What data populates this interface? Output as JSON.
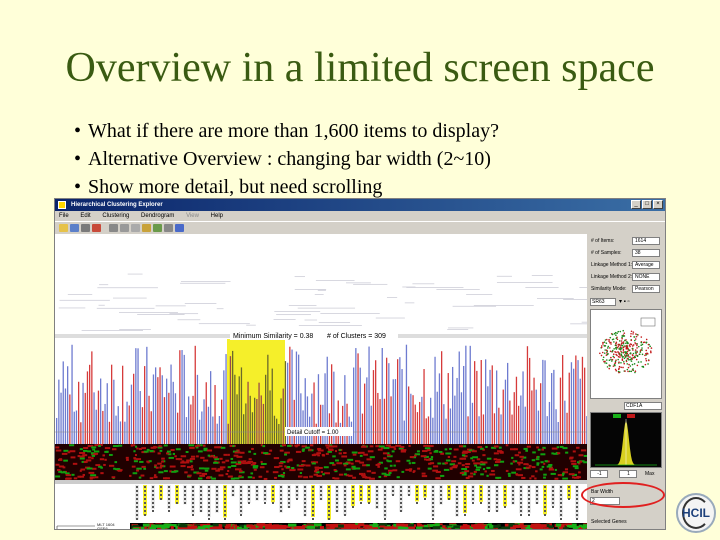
{
  "slide": {
    "title": "Overview in a limited screen space",
    "bullets": [
      "What if there are more than 1,600 items to display?",
      "Alternative Overview : changing bar width (2~10)",
      "Show more detail, but need scrolling"
    ],
    "bullet_glyph": "•"
  },
  "window": {
    "title": "Hierarchical Clustering Explorer",
    "buttons": {
      "minimize": "_",
      "maximize": "□",
      "close": "×"
    }
  },
  "menu": [
    "File",
    "Edit",
    "Clustering",
    "Dendrogram",
    "View",
    "Help"
  ],
  "menu_disabled": [
    "View"
  ],
  "toolbar_icons": [
    "open-icon",
    "save-icon",
    "print-icon",
    "cluster-icon",
    "cut-icon",
    "copy-icon",
    "paste-icon",
    "zoom-icon",
    "refresh-icon",
    "settings-icon",
    "help-icon"
  ],
  "viz": {
    "min_similarity": "Minimum Similarity = 0.38",
    "num_clusters": "# of Clusters = 309",
    "detail_cutoff": "Detail Cutoff = 1.00",
    "gene_labels": [
      "MLT 1604",
      "GSE6",
      "P53-S",
      "MDR9",
      "CD44",
      "CHL MJ",
      "GPR 2C",
      "TDA",
      "FCRGM"
    ],
    "highlight_color": "#f5ef2a",
    "red_color": "#d63b3b",
    "blue_color": "#6e7bd0"
  },
  "sidebar": {
    "fields": [
      {
        "label": "# of Items:",
        "value": "1614"
      },
      {
        "label": "# of Samples:",
        "value": "38"
      },
      {
        "label": "Linkage Method 1:",
        "value": "Average"
      },
      {
        "label": "Linkage Method 2:",
        "value": "NONE"
      },
      {
        "label": "Similarity Mode:",
        "value": "Pearson"
      }
    ],
    "scatter_x": "SR63",
    "scatter_y": "CDF1A",
    "hist_min": "-1",
    "hist_max": "1",
    "hist_mode": "Max",
    "bar_width_label": "Bar Width",
    "bar_width_value": "2",
    "selected_genes_label": "Selected Genes"
  },
  "logo": {
    "text": "HCIL"
  }
}
